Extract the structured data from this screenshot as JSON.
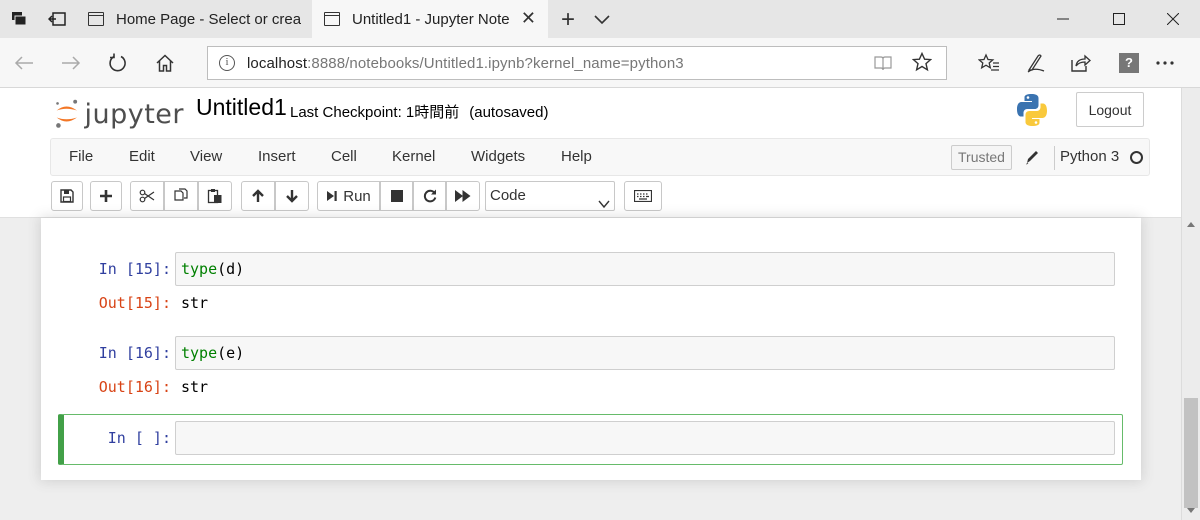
{
  "browser": {
    "tabs": [
      {
        "title": "Home Page - Select or creat",
        "active": false
      },
      {
        "title": "Untitled1 - Jupyter Note",
        "active": true
      }
    ],
    "close_glyph": "✕",
    "new_tab_glyph": "+",
    "address": {
      "host": "localhost",
      "rest": ":8888/notebooks/Untitled1.ipynb?kernel_name=python3"
    },
    "help_label": "?"
  },
  "jupyter": {
    "logo_text": "jupyter",
    "notebook_name": "Untitled1",
    "checkpoint": "Last Checkpoint: 1時間前",
    "autosave": "(autosaved)",
    "logout_label": "Logout",
    "menu": [
      "File",
      "Edit",
      "View",
      "Insert",
      "Cell",
      "Kernel",
      "Widgets",
      "Help"
    ],
    "trusted_label": "Trusted",
    "kernel_name": "Python 3",
    "run_label": "Run",
    "cell_type": "Code"
  },
  "cells": [
    {
      "in_prompt": "In [15]:",
      "fn": "type",
      "arg": "(d)",
      "out_prompt": "Out[15]:",
      "output": "str"
    },
    {
      "in_prompt": "In [16]:",
      "fn": "type",
      "arg": "(e)",
      "out_prompt": "Out[16]:",
      "output": "str"
    },
    {
      "in_prompt": "In [ ]:",
      "fn": "",
      "arg": "",
      "selected": true
    }
  ],
  "colors": {
    "prompt_in": "#303f9f",
    "prompt_out": "#d84315",
    "code_builtin": "#008000",
    "selected_cell_border": "#42a048"
  }
}
